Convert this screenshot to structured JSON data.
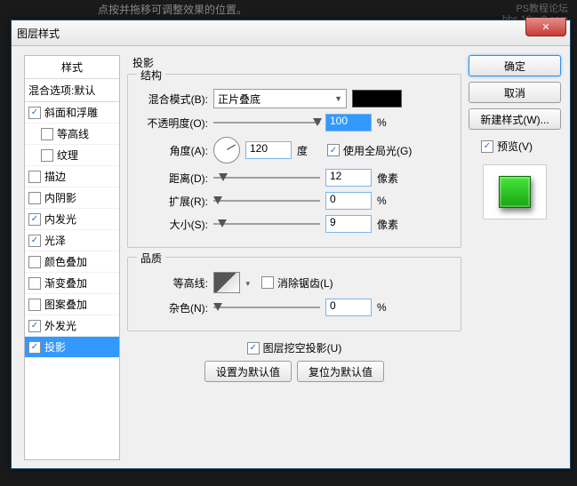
{
  "background": {
    "hint": "点按并拖移可调整效果的位置。",
    "wm1": "PS教程论坛",
    "wm2": "bbs.16xx8.com"
  },
  "dialog": {
    "title": "图层样式"
  },
  "styles": {
    "head": "样式",
    "sub": "混合选项:默认",
    "items": [
      {
        "label": "斜面和浮雕",
        "checked": true,
        "indent": false
      },
      {
        "label": "等高线",
        "checked": false,
        "indent": true
      },
      {
        "label": "纹理",
        "checked": false,
        "indent": true
      },
      {
        "label": "描边",
        "checked": false,
        "indent": false
      },
      {
        "label": "内阴影",
        "checked": false,
        "indent": false
      },
      {
        "label": "内发光",
        "checked": true,
        "indent": false
      },
      {
        "label": "光泽",
        "checked": true,
        "indent": false
      },
      {
        "label": "颜色叠加",
        "checked": false,
        "indent": false
      },
      {
        "label": "渐变叠加",
        "checked": false,
        "indent": false
      },
      {
        "label": "图案叠加",
        "checked": false,
        "indent": false
      },
      {
        "label": "外发光",
        "checked": true,
        "indent": false
      },
      {
        "label": "投影",
        "checked": true,
        "indent": false,
        "selected": true
      }
    ]
  },
  "main": {
    "title": "投影",
    "structure": {
      "legend": "结构",
      "blend_label": "混合模式(B):",
      "blend_value": "正片叠底",
      "opacity_label": "不透明度(O):",
      "opacity_value": "100",
      "opacity_unit": "%",
      "angle_label": "角度(A):",
      "angle_value": "120",
      "angle_unit": "度",
      "global_label": "使用全局光(G)",
      "global_on": true,
      "distance_label": "距离(D):",
      "distance_value": "12",
      "distance_unit": "像素",
      "spread_label": "扩展(R):",
      "spread_value": "0",
      "spread_unit": "%",
      "size_label": "大小(S):",
      "size_value": "9",
      "size_unit": "像素"
    },
    "quality": {
      "legend": "品质",
      "contour_label": "等高线:",
      "antialias_label": "消除锯齿(L)",
      "antialias_on": false,
      "noise_label": "杂色(N):",
      "noise_value": "0",
      "noise_unit": "%"
    },
    "knockout": {
      "label": "图层挖空投影(U)",
      "on": true
    },
    "defaults": {
      "set": "设置为默认值",
      "reset": "复位为默认值"
    }
  },
  "right": {
    "ok": "确定",
    "cancel": "取消",
    "newstyle": "新建样式(W)...",
    "preview": "预览(V)"
  }
}
